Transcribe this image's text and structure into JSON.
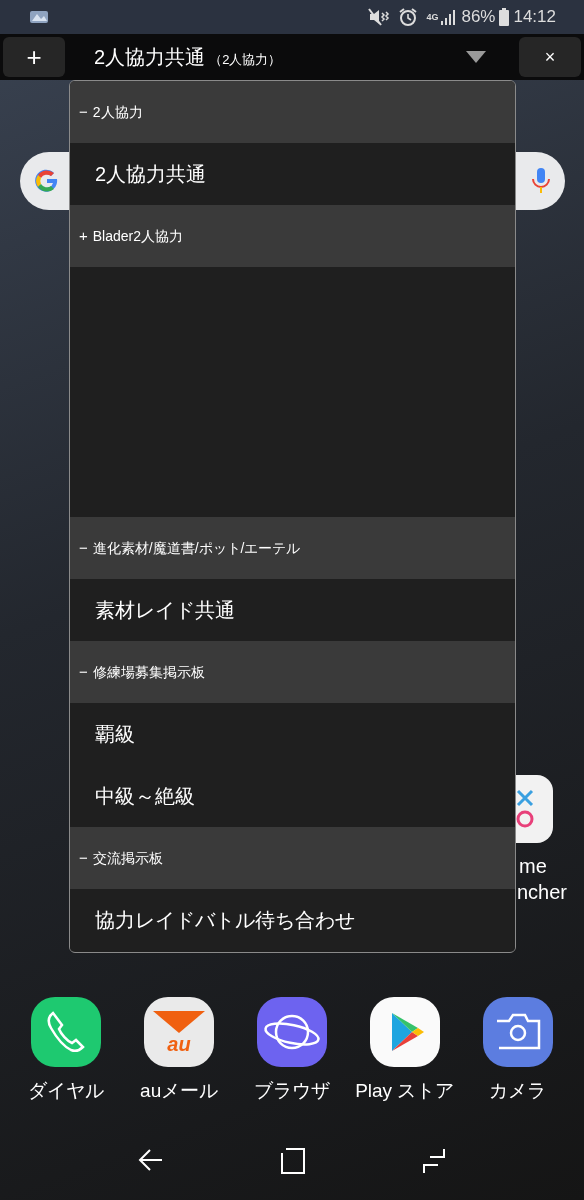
{
  "status_bar": {
    "battery": "86%",
    "time": "14:12",
    "network": "4G"
  },
  "top_bar": {
    "add_button": "+",
    "title": "2人協力共通",
    "subtitle": "（2人協力）",
    "close_button": "×"
  },
  "dropdown": {
    "groups": [
      {
        "sign": "−",
        "label": "2人協力",
        "items": [
          "2人協力共通"
        ]
      },
      {
        "sign": "+",
        "label": "Blader2人協力"
      },
      {
        "sign": "−",
        "label": "進化素材/魔道書/ポット/エーテル",
        "items": [
          "素材レイド共通"
        ]
      },
      {
        "sign": "−",
        "label": "修練場募集掲示板",
        "items": [
          "覇級",
          "中級～絶級"
        ]
      },
      {
        "sign": "−",
        "label": "交流掲示板",
        "items": [
          "協力レイドバトル待ち合わせ"
        ]
      }
    ]
  },
  "home_app": {
    "label_lines": [
      "me",
      "ncher"
    ]
  },
  "dock": [
    {
      "kind": "phone",
      "label": "ダイヤル"
    },
    {
      "kind": "mail",
      "label": "auメール",
      "icon_text": "au"
    },
    {
      "kind": "browser",
      "label": "ブラウザ"
    },
    {
      "kind": "store",
      "label": "Play ストア"
    },
    {
      "kind": "camera",
      "label": "カメラ"
    }
  ]
}
